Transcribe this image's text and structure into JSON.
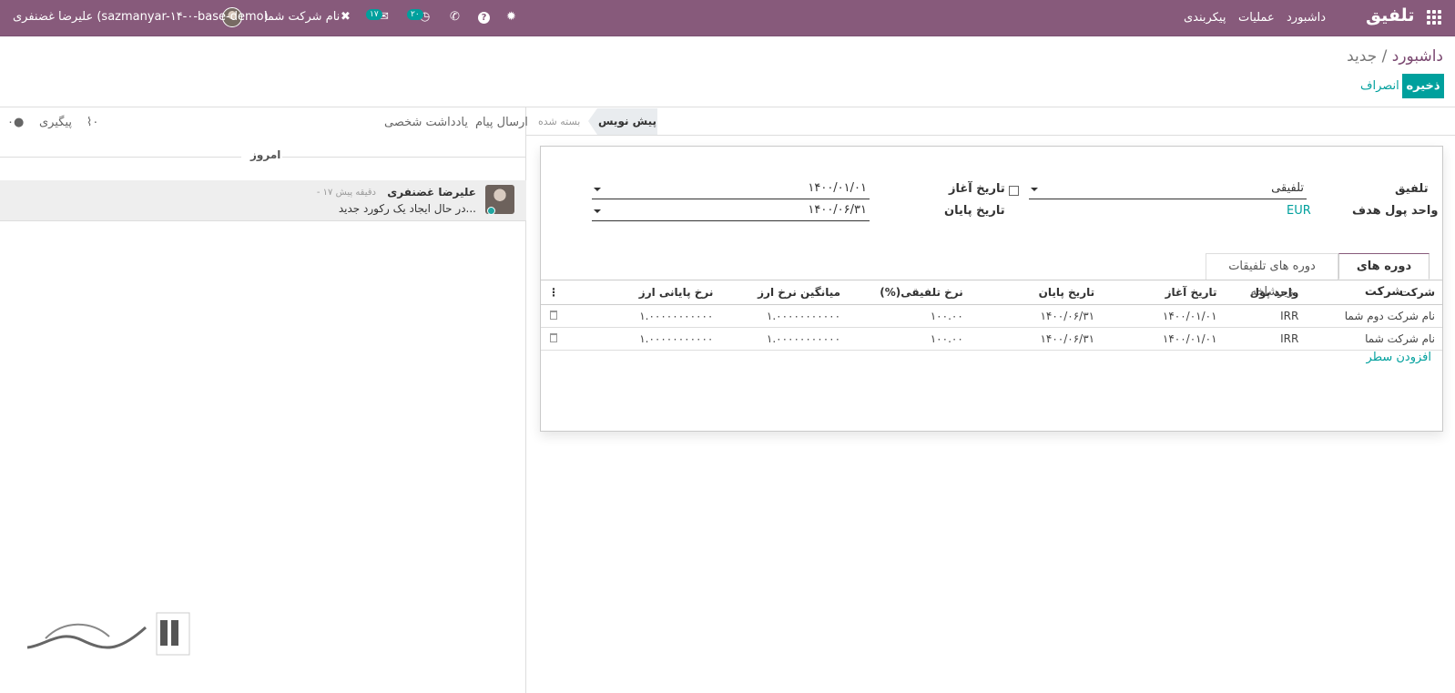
{
  "topbar": {
    "brand": "تلفیق",
    "menu": [
      "داشبورد",
      "عملیات",
      "پیکربندی"
    ],
    "activity_count": "۲۰",
    "message_count": "۱۷",
    "company": "نام شرکت شما",
    "user": "علیرضا غضنفری (sazmanyar-۱۴-۰-base-demo)",
    "color": "#875a7b"
  },
  "control": {
    "breadcrumb_root": "داشبورد",
    "breadcrumb_sep": " / ",
    "breadcrumb_current": "جدید",
    "save_label": "ذخیره",
    "discard_label": "انصراف"
  },
  "status": {
    "active": "پیش نویس",
    "closed": "بسته شده"
  },
  "form": {
    "consolidation_label": "تلفیق",
    "consolidation_value": "تلفیقی",
    "currency_label": "واحد پول هدف",
    "currency_value": "EUR",
    "start_label": "تاریخ آغاز",
    "start_value": "۱۴۰۰/۰۱/۰۱",
    "end_label": "تاریخ پایان",
    "end_value": "۱۴۰۰/۰۶/۳۱"
  },
  "tabs": {
    "company_periods": "دوره های شرکت",
    "sub_periods": "دوره های تلفیقات زیرشاخه"
  },
  "table": {
    "headers": [
      "شرکت",
      "واحد پول",
      "تاریخ آغاز",
      "تاریخ پایان",
      "نرخ تلفیقی(%)",
      "میانگین نرخ ارز",
      "نرخ پایانی ارز"
    ],
    "rows": [
      [
        "نام شرکت دوم شما",
        "IRR",
        "۱۴۰۰/۰۱/۰۱",
        "۱۴۰۰/۰۶/۳۱",
        "۱۰۰.۰۰",
        "۱.۰۰۰۰۰۰۰۰۰۰۰",
        "۱.۰۰۰۰۰۰۰۰۰۰۰"
      ],
      [
        "نام شرکت شما",
        "IRR",
        "۱۴۰۰/۰۱/۰۱",
        "۱۴۰۰/۰۶/۳۱",
        "۱۰۰.۰۰",
        "۱.۰۰۰۰۰۰۰۰۰۰۰",
        "۱.۰۰۰۰۰۰۰۰۰۰۰"
      ]
    ],
    "add_line": "افزودن سطر"
  },
  "chatter": {
    "send_message": "ارسال پیام",
    "log_note": "یادداشت شخصی",
    "follow": "پیگیری",
    "attachments": "۰",
    "followers": "۰",
    "today": "امروز",
    "author": "علیرضا غضنفری",
    "time": "- ۱۷ دقیقه پیش",
    "body": "در حال ایجاد یک رکورد جدید..."
  }
}
